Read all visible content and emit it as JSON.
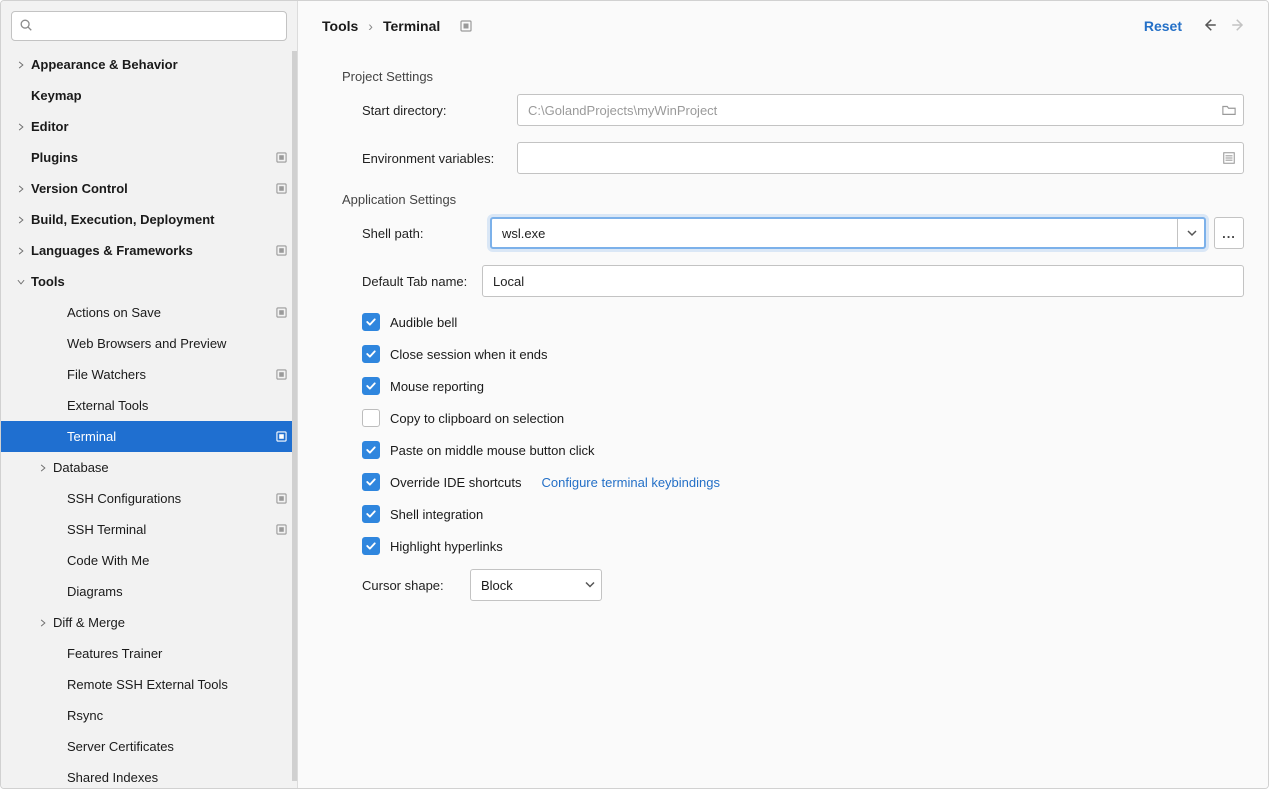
{
  "search": {
    "placeholder": ""
  },
  "sidebar": {
    "items": [
      {
        "label": "Appearance & Behavior",
        "bold": true,
        "chev": "right",
        "badge": false,
        "depth": 0
      },
      {
        "label": "Keymap",
        "bold": true,
        "chev": "",
        "badge": false,
        "depth": 0
      },
      {
        "label": "Editor",
        "bold": true,
        "chev": "right",
        "badge": false,
        "depth": 0
      },
      {
        "label": "Plugins",
        "bold": true,
        "chev": "",
        "badge": true,
        "depth": 0
      },
      {
        "label": "Version Control",
        "bold": true,
        "chev": "right",
        "badge": true,
        "depth": 0
      },
      {
        "label": "Build, Execution, Deployment",
        "bold": true,
        "chev": "right",
        "badge": false,
        "depth": 0
      },
      {
        "label": "Languages & Frameworks",
        "bold": true,
        "chev": "right",
        "badge": true,
        "depth": 0
      },
      {
        "label": "Tools",
        "bold": true,
        "chev": "down",
        "badge": false,
        "depth": 0
      },
      {
        "label": "Actions on Save",
        "bold": false,
        "chev": "",
        "badge": true,
        "depth": 1
      },
      {
        "label": "Web Browsers and Preview",
        "bold": false,
        "chev": "",
        "badge": false,
        "depth": 1
      },
      {
        "label": "File Watchers",
        "bold": false,
        "chev": "",
        "badge": true,
        "depth": 1
      },
      {
        "label": "External Tools",
        "bold": false,
        "chev": "",
        "badge": false,
        "depth": 1
      },
      {
        "label": "Terminal",
        "bold": false,
        "chev": "",
        "badge": true,
        "depth": 1,
        "selected": true
      },
      {
        "label": "Database",
        "bold": false,
        "chev": "right",
        "badge": false,
        "depth": 1
      },
      {
        "label": "SSH Configurations",
        "bold": false,
        "chev": "",
        "badge": true,
        "depth": 1
      },
      {
        "label": "SSH Terminal",
        "bold": false,
        "chev": "",
        "badge": true,
        "depth": 1
      },
      {
        "label": "Code With Me",
        "bold": false,
        "chev": "",
        "badge": false,
        "depth": 1
      },
      {
        "label": "Diagrams",
        "bold": false,
        "chev": "",
        "badge": false,
        "depth": 1
      },
      {
        "label": "Diff & Merge",
        "bold": false,
        "chev": "right",
        "badge": false,
        "depth": 1
      },
      {
        "label": "Features Trainer",
        "bold": false,
        "chev": "",
        "badge": false,
        "depth": 1
      },
      {
        "label": "Remote SSH External Tools",
        "bold": false,
        "chev": "",
        "badge": false,
        "depth": 1
      },
      {
        "label": "Rsync",
        "bold": false,
        "chev": "",
        "badge": false,
        "depth": 1
      },
      {
        "label": "Server Certificates",
        "bold": false,
        "chev": "",
        "badge": false,
        "depth": 1
      },
      {
        "label": "Shared Indexes",
        "bold": false,
        "chev": "",
        "badge": false,
        "depth": 1
      }
    ]
  },
  "breadcrumb": {
    "parent": "Tools",
    "sep": "›",
    "current": "Terminal"
  },
  "actions": {
    "reset": "Reset"
  },
  "project": {
    "section_title": "Project Settings",
    "start_dir_label": "Start directory:",
    "start_dir_placeholder": "C:\\GolandProjects\\myWinProject",
    "start_dir_value": "",
    "env_label": "Environment variables:",
    "env_value": ""
  },
  "app": {
    "section_title": "Application Settings",
    "shell_path_label": "Shell path:",
    "shell_path_value": "wsl.exe",
    "default_tab_label": "Default Tab name:",
    "default_tab_value": "Local",
    "checkboxes": [
      {
        "label": "Audible bell",
        "checked": true
      },
      {
        "label": "Close session when it ends",
        "checked": true
      },
      {
        "label": "Mouse reporting",
        "checked": true
      },
      {
        "label": "Copy to clipboard on selection",
        "checked": false
      },
      {
        "label": "Paste on middle mouse button click",
        "checked": true
      },
      {
        "label": "Override IDE shortcuts",
        "checked": true,
        "link": "Configure terminal keybindings"
      },
      {
        "label": "Shell integration",
        "checked": true
      },
      {
        "label": "Highlight hyperlinks",
        "checked": true
      }
    ],
    "cursor_shape_label": "Cursor shape:",
    "cursor_shape_value": "Block",
    "ellipsis": "..."
  }
}
